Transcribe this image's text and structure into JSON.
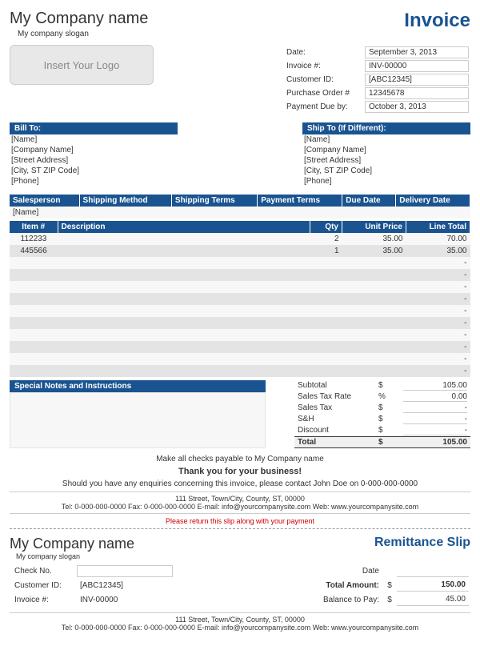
{
  "header": {
    "company_name": "My Company name",
    "slogan": "My company slogan",
    "invoice_title": "Invoice",
    "logo_placeholder": "Insert Your Logo"
  },
  "meta": {
    "labels": {
      "date": "Date:",
      "invoice_no": "Invoice #:",
      "customer_id": "Customer ID:",
      "po": "Purchase Order #",
      "due": "Payment Due by:"
    },
    "values": {
      "date": "September 3, 2013",
      "invoice_no": "INV-00000",
      "customer_id": "[ABC12345]",
      "po": "12345678",
      "due": "October 3, 2013"
    }
  },
  "bill_to": {
    "header": "Bill To:",
    "lines": [
      "[Name]",
      "[Company Name]",
      "[Street Address]",
      "[City, ST  ZIP Code]",
      "[Phone]"
    ]
  },
  "ship_to": {
    "header": "Ship To (If Different):",
    "lines": [
      "[Name]",
      "[Company Name]",
      "[Street Address]",
      "[City, ST  ZIP Code]",
      "[Phone]"
    ]
  },
  "terms": {
    "headers": [
      "Salesperson",
      "Shipping Method",
      "Shipping Terms",
      "Payment Terms",
      "Due Date",
      "Delivery Date"
    ],
    "row": [
      "[Name]",
      "",
      "",
      "",
      "",
      ""
    ]
  },
  "items": {
    "headers": [
      "Item #",
      "Description",
      "Qty",
      "Unit Price",
      "Line Total"
    ],
    "rows": [
      {
        "item": "112233",
        "desc": "",
        "qty": "2",
        "price": "35.00",
        "total": "70.00"
      },
      {
        "item": "445566",
        "desc": "",
        "qty": "1",
        "price": "35.00",
        "total": "35.00"
      },
      {
        "item": "",
        "desc": "",
        "qty": "",
        "price": "",
        "total": "-"
      },
      {
        "item": "",
        "desc": "",
        "qty": "",
        "price": "",
        "total": "-"
      },
      {
        "item": "",
        "desc": "",
        "qty": "",
        "price": "",
        "total": "-"
      },
      {
        "item": "",
        "desc": "",
        "qty": "",
        "price": "",
        "total": "-"
      },
      {
        "item": "",
        "desc": "",
        "qty": "",
        "price": "",
        "total": "-"
      },
      {
        "item": "",
        "desc": "",
        "qty": "",
        "price": "",
        "total": "-"
      },
      {
        "item": "",
        "desc": "",
        "qty": "",
        "price": "",
        "total": "-"
      },
      {
        "item": "",
        "desc": "",
        "qty": "",
        "price": "",
        "total": "-"
      },
      {
        "item": "",
        "desc": "",
        "qty": "",
        "price": "",
        "total": "-"
      },
      {
        "item": "",
        "desc": "",
        "qty": "",
        "price": "",
        "total": "-"
      }
    ]
  },
  "notes_header": "Special Notes and Instructions",
  "totals": {
    "rows": [
      {
        "label": "Subtotal",
        "sym": "$",
        "val": "105.00"
      },
      {
        "label": "Sales Tax Rate",
        "sym": "%",
        "val": "0.00"
      },
      {
        "label": "Sales Tax",
        "sym": "$",
        "val": "-"
      },
      {
        "label": "S&H",
        "sym": "$",
        "val": "-"
      },
      {
        "label": "Discount",
        "sym": "$",
        "val": "-"
      }
    ],
    "total": {
      "label": "Total",
      "sym": "$",
      "val": "105.00"
    }
  },
  "footer": {
    "payable": "Make all checks payable to My Company name",
    "thanks": "Thank you for your business!",
    "enquiry": "Should you have any enquiries concerning this invoice, please contact John Doe on 0-000-000-0000",
    "addr1": "111 Street, Town/City, County, ST, 00000",
    "addr2": "Tel: 0-000-000-0000 Fax: 0-000-000-0000 E-mail: info@yourcompanysite.com Web: www.yourcompanysite.com",
    "return_note": "Please return this slip along with your payment"
  },
  "remit": {
    "company_name": "My Company name",
    "slogan": "My company slogan",
    "title": "Remittance Slip",
    "labels": {
      "check": "Check No.",
      "customer": "Customer ID:",
      "invoice": "Invoice #:",
      "date": "Date",
      "total": "Total Amount:",
      "balance": "Balance to Pay:"
    },
    "values": {
      "customer": "[ABC12345]",
      "invoice": "INV-00000",
      "total": "150.00",
      "balance": "45.00"
    },
    "addr1": "111 Street, Town/City, County, ST, 00000",
    "addr2": "Tel: 0-000-000-0000 Fax: 0-000-000-0000 E-mail: info@yourcompanysite.com Web: www.yourcompanysite.com"
  }
}
